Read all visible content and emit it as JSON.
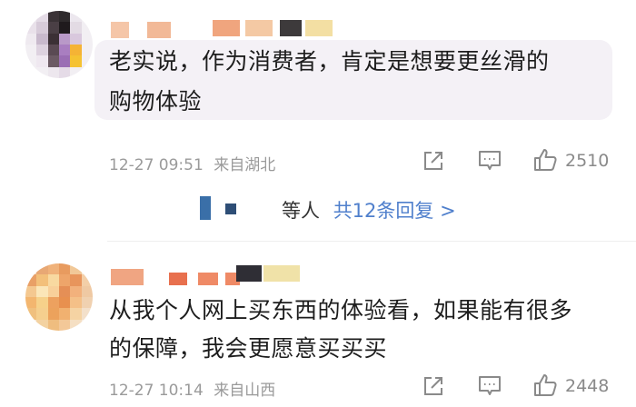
{
  "colors": {
    "bubble_bg": "#f4f1f6",
    "meta_text": "#9a9a9a",
    "link_blue": "#4f7fcc",
    "divider": "#eeeeee"
  },
  "comments": [
    {
      "text_line1": "老实说，作为消费者，肯定是想要更丝滑的",
      "text_line2": "购物体验",
      "time": "12-27 09:51",
      "location": "来自湖北",
      "like_count": "2510",
      "icons": [
        "share-icon",
        "comment-icon",
        "like-icon"
      ]
    },
    {
      "text_line1": "从我个人网上买东西的体验看，如果能有很多",
      "text_line2": "的保障，我会更愿意买买买",
      "time": "12-27 10:14",
      "location": "来自山西",
      "like_count": "2448",
      "icons": [
        "share-icon",
        "comment-icon",
        "like-icon"
      ]
    }
  ],
  "replies": {
    "prefix": "等人",
    "link": "共12条回复 >"
  }
}
